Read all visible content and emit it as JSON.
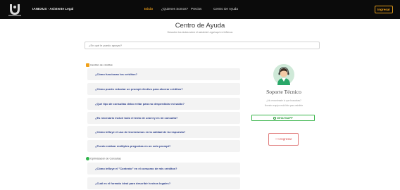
{
  "navbar": {
    "brand": "IANEXUS - Asistente Legal",
    "links": [
      {
        "label": "Inicio"
      },
      {
        "label": "¿Quienes Somos?"
      },
      {
        "label": "Precios"
      },
      {
        "label": "Centro De Ayuda"
      }
    ],
    "login_label": "Ingresar",
    "accent_color": "#f0a11a"
  },
  "header": {
    "title": "Centro de Ayuda",
    "subtitle": "Descubre tus dudas sobre el asistente Legal aqui en IANexus"
  },
  "search": {
    "placeholder": "¿En qué le puedo apoyar?"
  },
  "faq": {
    "sections": [
      {
        "title": "Gestión de créditos",
        "icon": "coin-icon",
        "questions": [
          "¿Cómo funcionan los créditos?",
          "¿Cómo puedo redactar un prompt efectivo para ahorrar créditos?",
          "¿Qué tipo de consultas debo evitar para no desperdiciar mi saldo?",
          "¿Es necesario incluir todo el texto de una ley en mi consulta?",
          "¿Cómo influye el uso de tecnicismos en la calidad de la respuesta?",
          "¿Puedo realizar múltiples preguntas en un solo prompt?"
        ]
      },
      {
        "title": "Optimización de Consultas",
        "icon": "check-circle-icon",
        "questions": [
          "¿Cómo influye el \"Contexto\" en el consumo de mis créditos?",
          "¿Cuál es el formato ideal para describir hechos legales?"
        ]
      }
    ]
  },
  "support": {
    "title": "Soporte Técnico",
    "text_line1": "¿No encontraste lo que buscabas?",
    "text_line2": "Nuestro equipo está listo para asistirte",
    "whatsapp_label": "WHATSAPP",
    "login_label": "Ingresar",
    "avatar_icon": "support-agent-icon",
    "whatsapp_color": "#39b54a",
    "login_color": "#d64646"
  }
}
